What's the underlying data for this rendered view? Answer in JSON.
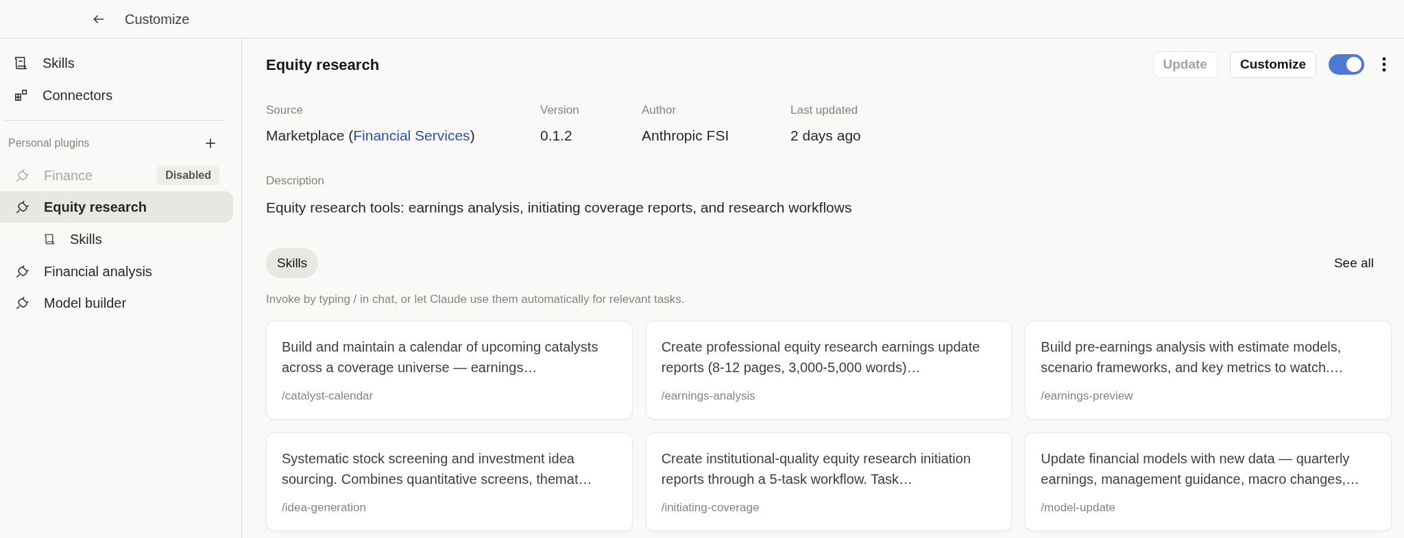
{
  "header": {
    "title": "Customize"
  },
  "sidebar": {
    "nav": [
      {
        "label": "Skills",
        "kind": "skills",
        "selected": false
      },
      {
        "label": "Connectors",
        "kind": "connectors",
        "selected": false
      }
    ],
    "section_title": "Personal plugins",
    "plugins": [
      {
        "label": "Finance",
        "disabled": true,
        "badge": "Disabled",
        "selected": false
      },
      {
        "label": "Equity research",
        "disabled": false,
        "selected": true,
        "children": [
          {
            "label": "Skills",
            "selected": false
          }
        ]
      },
      {
        "label": "Financial analysis",
        "disabled": false,
        "selected": false
      },
      {
        "label": "Model builder",
        "disabled": false,
        "selected": false
      }
    ]
  },
  "plugin": {
    "title": "Equity research",
    "update_button": {
      "label": "Update",
      "disabled": true
    },
    "customize_button": {
      "label": "Customize"
    },
    "enabled": true,
    "meta": [
      {
        "label": "Source",
        "value_prefix": "Marketplace (",
        "link": "Financial Services",
        "value_suffix": ")"
      },
      {
        "label": "Version",
        "value": "0.1.2"
      },
      {
        "label": "Author",
        "value": "Anthropic FSI"
      },
      {
        "label": "Last updated",
        "value": "2 days ago"
      }
    ],
    "description_label": "Description",
    "description": "Equity research tools: earnings analysis, initiating coverage reports, and research workflows",
    "tab": {
      "label": "Skills",
      "selected": true
    },
    "see_all": "See all",
    "hint": "Invoke by typing / in chat, or let Claude use them automatically for relevant tasks.",
    "skills": [
      {
        "text": "Build and maintain a calendar of upcoming catalysts across a coverage universe — earnings…",
        "command": "/catalyst-calendar"
      },
      {
        "text": "Create professional equity research earnings update reports (8-12 pages, 3,000-5,000 words)…",
        "command": "/earnings-analysis"
      },
      {
        "text": "Build pre-earnings analysis with estimate models, scenario frameworks, and key metrics to watch.…",
        "command": "/earnings-preview"
      },
      {
        "text": "Systematic stock screening and investment idea sourcing. Combines quantitative screens, themat…",
        "command": "/idea-generation"
      },
      {
        "text": "Create institutional-quality equity research initiation reports through a 5-task workflow. Task…",
        "command": "/initiating-coverage"
      },
      {
        "text": "Update financial models with new data — quarterly earnings, management guidance, macro changes,…",
        "command": "/model-update"
      }
    ]
  }
}
